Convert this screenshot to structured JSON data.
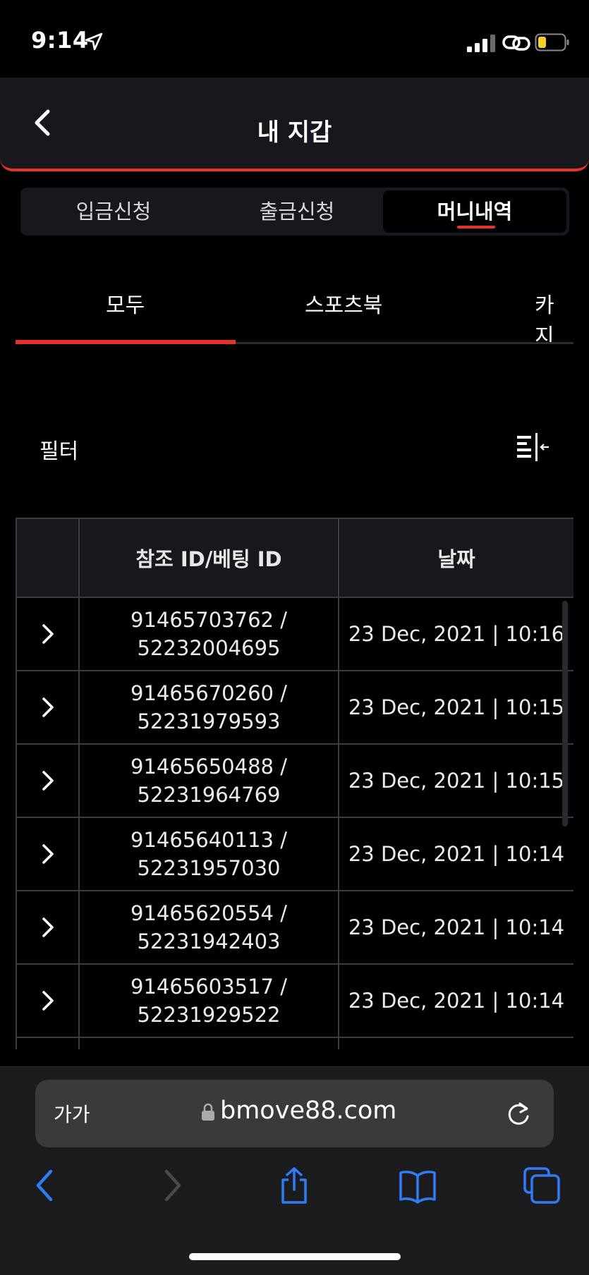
{
  "status_bar": {
    "time": "9:14"
  },
  "header": {
    "title": "내 지갑"
  },
  "segment_tabs": [
    {
      "label": "입금신청"
    },
    {
      "label": "출금신청"
    },
    {
      "label": "머니내역"
    }
  ],
  "category_tabs": [
    {
      "label": "모두"
    },
    {
      "label": "스포츠북"
    },
    {
      "label": "카지"
    }
  ],
  "filter": {
    "label": "필터"
  },
  "table": {
    "headers": [
      "",
      "참조 ID/베팅 ID",
      "날짜"
    ],
    "rows": [
      {
        "ref": "91465703762 /",
        "bet": "52232004695",
        "date": "23 Dec, 2021 | 10:16"
      },
      {
        "ref": "91465670260 /",
        "bet": "52231979593",
        "date": "23 Dec, 2021 | 10:15"
      },
      {
        "ref": "91465650488 /",
        "bet": "52231964769",
        "date": "23 Dec, 2021 | 10:15"
      },
      {
        "ref": "91465640113 /",
        "bet": "52231957030",
        "date": "23 Dec, 2021 | 10:14"
      },
      {
        "ref": "91465620554 /",
        "bet": "52231942403",
        "date": "23 Dec, 2021 | 10:14"
      },
      {
        "ref": "91465603517 /",
        "bet": "52231929522",
        "date": "23 Dec, 2021 | 10:14"
      }
    ]
  },
  "browser": {
    "aa_label": "가가",
    "url": "bmove88.com"
  },
  "colors": {
    "accent": "#e5322d",
    "ios_blue": "#2f7cf6",
    "panel": "#17181d"
  }
}
